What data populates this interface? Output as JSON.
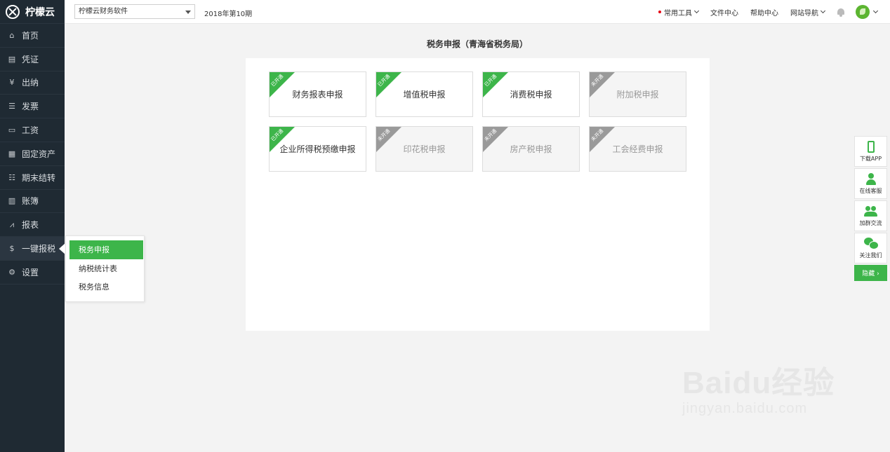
{
  "app": {
    "name": "柠檬云"
  },
  "sidebar": {
    "items": [
      {
        "label": "首页",
        "icon": "home-icon",
        "glyph": "⌂"
      },
      {
        "label": "凭证",
        "icon": "voucher-icon",
        "glyph": "▤"
      },
      {
        "label": "出纳",
        "icon": "cashier-icon",
        "glyph": "¥"
      },
      {
        "label": "发票",
        "icon": "invoice-icon",
        "glyph": "☰"
      },
      {
        "label": "工资",
        "icon": "salary-icon",
        "glyph": "▭"
      },
      {
        "label": "固定资产",
        "icon": "asset-icon",
        "glyph": "▦"
      },
      {
        "label": "期末结转",
        "icon": "closing-icon",
        "glyph": "☷"
      },
      {
        "label": "账簿",
        "icon": "ledger-icon",
        "glyph": "▥"
      },
      {
        "label": "报表",
        "icon": "report-icon",
        "glyph": "⩘"
      },
      {
        "label": "一键报税",
        "icon": "tax-icon",
        "glyph": "$"
      },
      {
        "label": "设置",
        "icon": "settings-icon",
        "glyph": "⚙"
      }
    ],
    "active_index": 9
  },
  "flyout": {
    "items": [
      "税务申报",
      "纳税统计表",
      "税务信息"
    ],
    "active_index": 0
  },
  "topbar": {
    "account_select": "柠檬云财务软件",
    "period": "2018年第10期",
    "links": {
      "tools": "常用工具",
      "files": "文件中心",
      "help": "帮助中心",
      "nav": "网站导航"
    }
  },
  "main": {
    "title": "税务申报（青海省税务局）",
    "ribbon_open": "已开通",
    "ribbon_closed": "未开通",
    "cards": [
      {
        "label": "财务报表申报",
        "open": true
      },
      {
        "label": "增值税申报",
        "open": true
      },
      {
        "label": "消费税申报",
        "open": true
      },
      {
        "label": "附加税申报",
        "open": false
      },
      {
        "label": "企业所得税预缴申报",
        "open": true
      },
      {
        "label": "印花税申报",
        "open": false
      },
      {
        "label": "房产税申报",
        "open": false
      },
      {
        "label": "工会经费申报",
        "open": false
      }
    ]
  },
  "float_bar": {
    "download_app": "下载APP",
    "online_service": "在线客服",
    "join_group": "加群交流",
    "follow_us": "关注我们",
    "hide": "隐藏 ›"
  },
  "watermark": {
    "brand": "Baidu经验",
    "url": "jingyan.baidu.com"
  },
  "colors": {
    "accent": "#3db54a",
    "sidebar_bg": "#1f2a33",
    "closed_ribbon": "#9a9a9a",
    "dot": "#e60012"
  }
}
